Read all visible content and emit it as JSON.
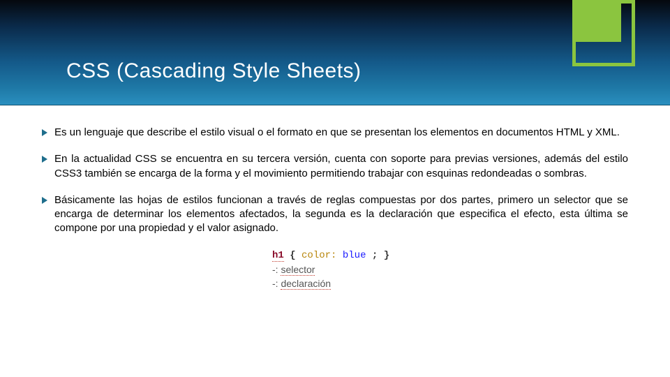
{
  "header": {
    "title": "CSS (Cascading Style Sheets)"
  },
  "bullets": [
    "Es un lenguaje que describe el estilo visual o el formato en que se presentan los elementos en documentos HTML y XML.",
    "En la actualidad CSS se encuentra en su tercera versión, cuenta con soporte para previas versiones, además del estilo CSS3 también se encarga de la forma y el movimiento permitiendo trabajar con esquinas redondeadas o sombras.",
    "Básicamente las hojas de estilos funcionan a través de reglas compuestas por dos partes, primero un selector que se encarga de determinar los elementos afectados, la segunda es la declaración que especifica el efecto, esta última se compone por una propiedad y el valor asignado."
  ],
  "code": {
    "selector": "h1",
    "open": "{",
    "property": "color:",
    "value": "blue",
    "semicolon": ";",
    "close": "}",
    "legend1_prefix": "-: ",
    "legend1": "selector",
    "legend2_prefix": "-: ",
    "legend2": "declaración"
  },
  "colors": {
    "accent_green": "#8bc53f",
    "bullet_teal": "#1f6e8c"
  }
}
